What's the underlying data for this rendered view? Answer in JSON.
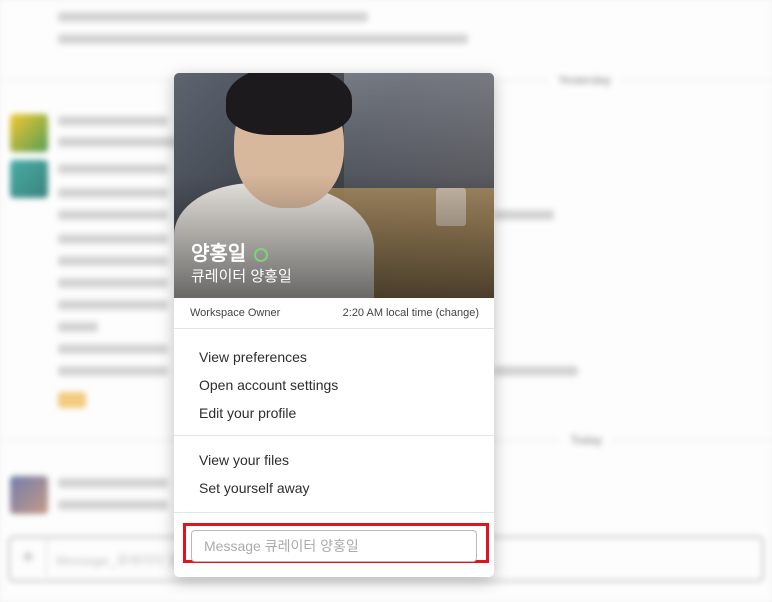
{
  "background": {
    "day_labels": [
      "Yesterday",
      "Today"
    ],
    "composer_plus": "+",
    "composer_placeholder": "Message_큐레이터 양홍일"
  },
  "profile": {
    "name": "양홍일",
    "title": "큐레이터 양홍일",
    "role": "Workspace Owner",
    "local_time": "2:20 AM local time (change)",
    "presence_color": "#7fd17f"
  },
  "menu_primary": [
    {
      "label": "View preferences"
    },
    {
      "label": "Open account settings"
    },
    {
      "label": "Edit your profile"
    }
  ],
  "menu_secondary": [
    {
      "label": "View your files"
    },
    {
      "label": "Set yourself away"
    }
  ],
  "message": {
    "placeholder": "Message 큐레이터 양홍일",
    "highlight_color": "#e0141e"
  }
}
